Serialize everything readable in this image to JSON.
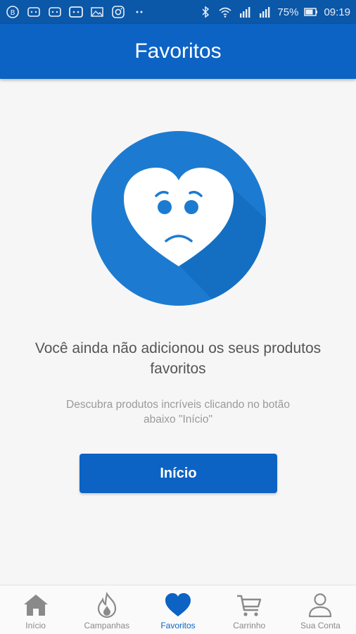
{
  "status_bar": {
    "battery": "75%",
    "time": "09:19"
  },
  "app_bar": {
    "title": "Favoritos"
  },
  "empty_state": {
    "headline": "Você ainda não adicionou os seus produtos favoritos",
    "subtext": "Descubra produtos incríveis clicando no botão abaixo \"Início\"",
    "button_label": "Início"
  },
  "bottom_nav": {
    "items": [
      {
        "label": "Início",
        "icon": "home-icon",
        "active": false
      },
      {
        "label": "Campanhas",
        "icon": "flame-icon",
        "active": false
      },
      {
        "label": "Favoritos",
        "icon": "heart-icon",
        "active": true
      },
      {
        "label": "Carrinho",
        "icon": "cart-icon",
        "active": false
      },
      {
        "label": "Sua Conta",
        "icon": "person-icon",
        "active": false
      }
    ]
  },
  "colors": {
    "primary": "#0c63c4",
    "status_bar": "#0b57a8",
    "circle": "#1c7bd0",
    "inactive": "#8a8a8a"
  }
}
